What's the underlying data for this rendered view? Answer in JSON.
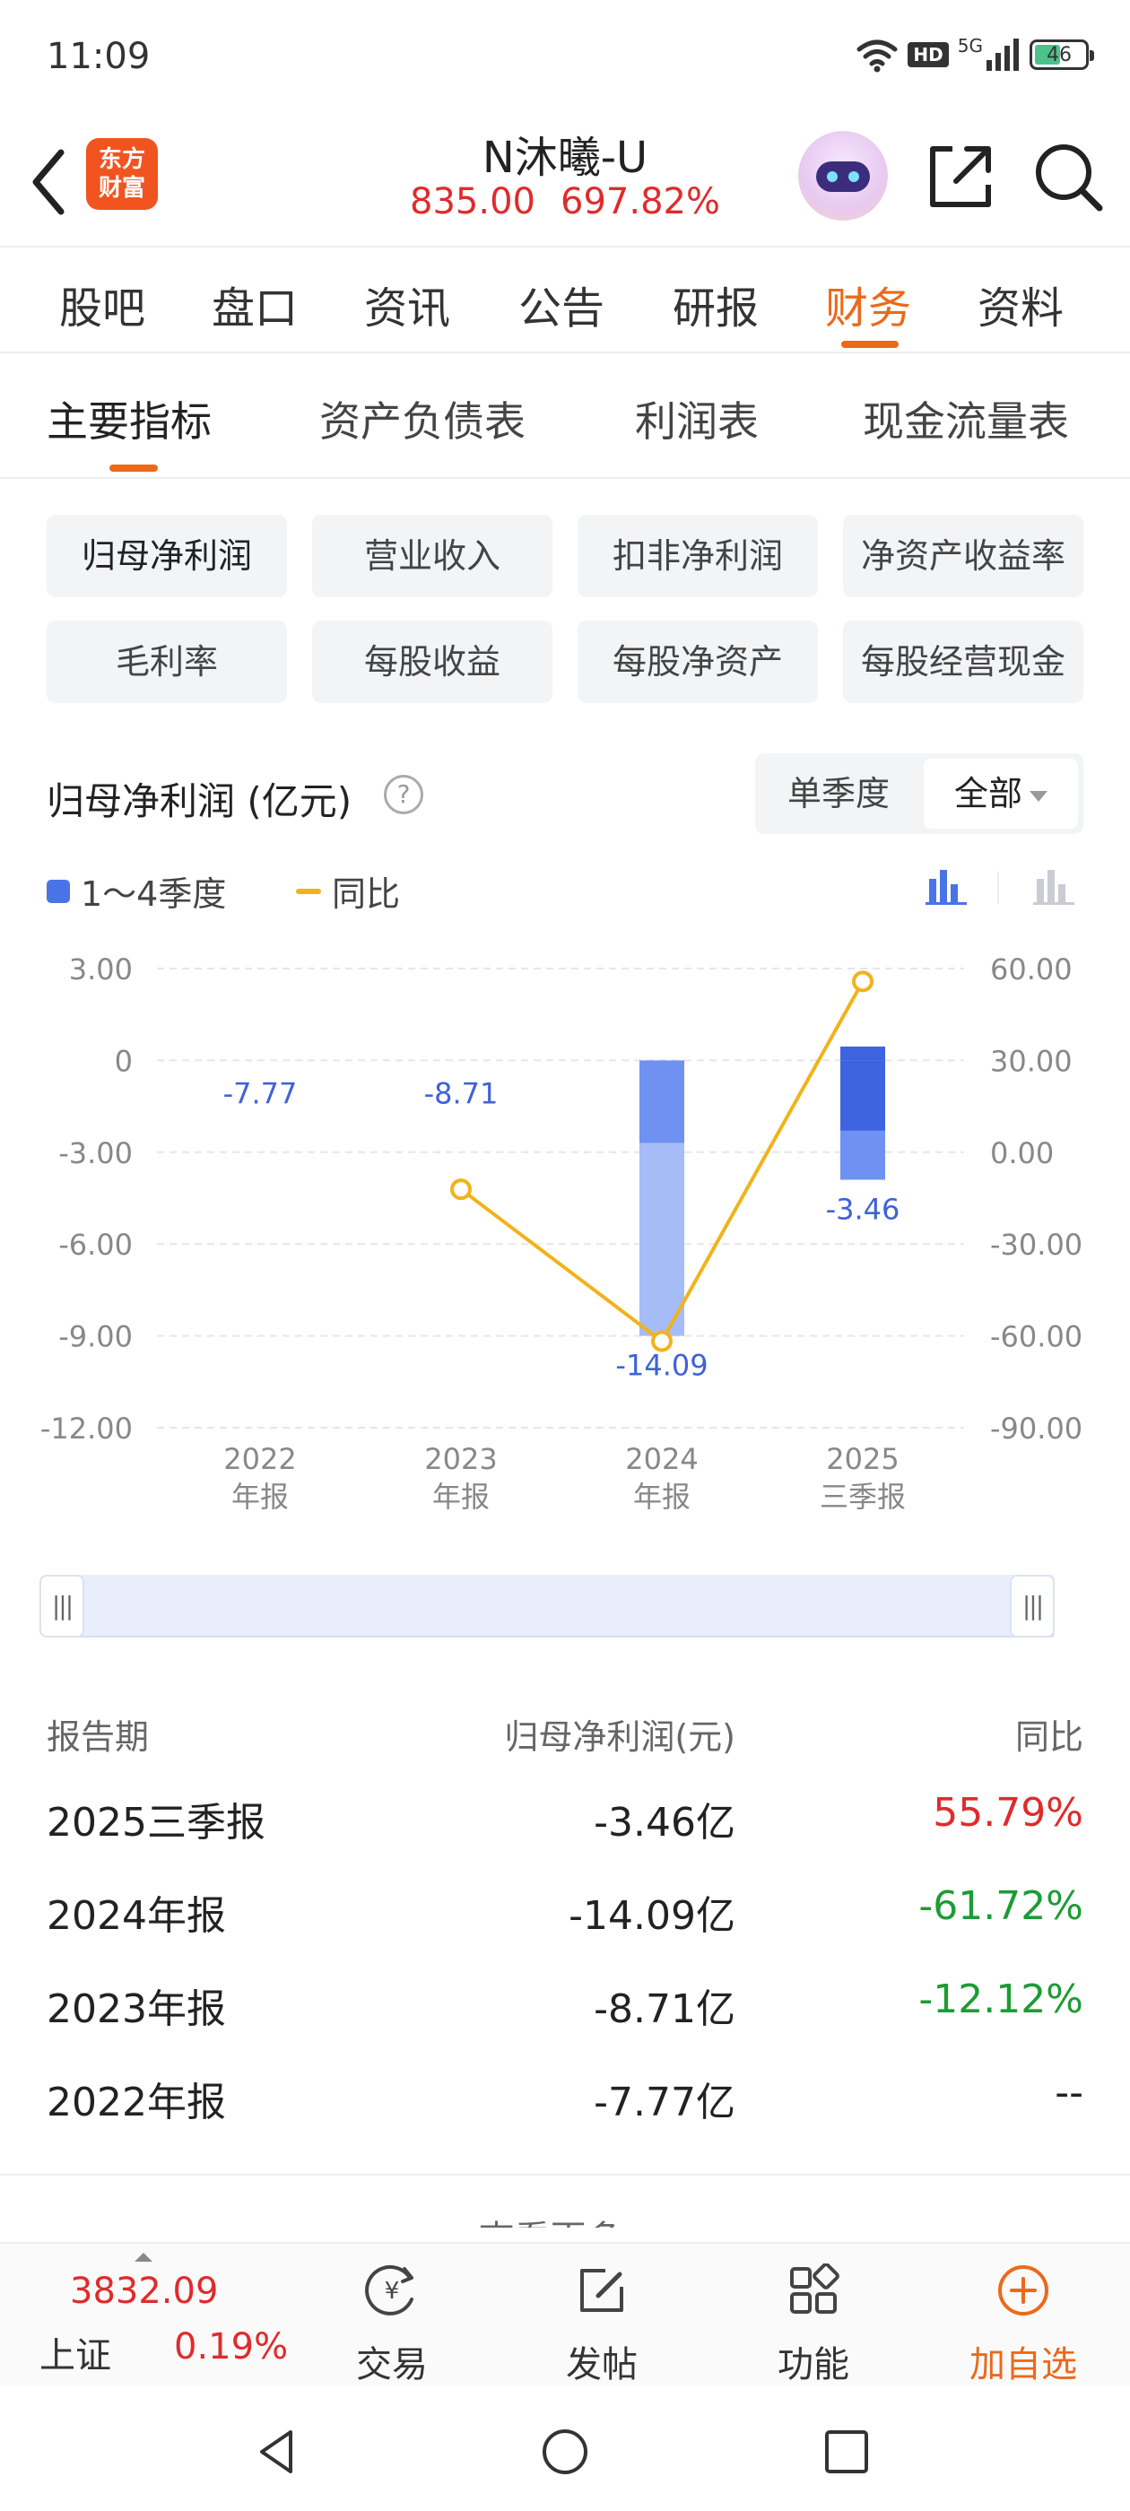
{
  "status": {
    "time": "11:09",
    "network": "5G",
    "hd": "HD",
    "battery": "46"
  },
  "header": {
    "logo": [
      "东方",
      "财富"
    ],
    "stock_name": "N沐曦-U",
    "price": "835.00",
    "change_pct": "697.82%"
  },
  "tabs": [
    "股吧",
    "盘口",
    "资讯",
    "公告",
    "研报",
    "财务",
    "资料"
  ],
  "active_tab": "财务",
  "subtabs": [
    "主要指标",
    "资产负债表",
    "利润表",
    "现金流量表"
  ],
  "active_subtab": "主要指标",
  "metric_chips": [
    "归母净利润",
    "营业收入",
    "扣非净利润",
    "净资产收益率",
    "毛利率",
    "每股收益",
    "每股净资产",
    "每股经营现金"
  ],
  "active_chip": "归母净利润",
  "chart_header": {
    "title": "归母净利润 (亿元)",
    "help": "?",
    "segment_left": "单季度",
    "segment_right": "全部"
  },
  "legend": {
    "bars": "1～4季度",
    "line": "同比"
  },
  "chart_data": {
    "type": "bar",
    "categories": [
      "2022\n年报",
      "2023\n年报",
      "2024\n年报",
      "2025\n三季报"
    ],
    "left_axis": {
      "ticks": [
        "3.00",
        "0",
        "-3.00",
        "-6.00",
        "-9.00",
        "-12.00"
      ],
      "ylim": [
        -12,
        3
      ]
    },
    "right_axis": {
      "ticks": [
        "60.00",
        "30.00",
        "0.00",
        "-30.00",
        "-60.00",
        "-90.00"
      ],
      "ylim": [
        -90,
        60
      ]
    },
    "bar_labels": [
      "-7.77",
      "-8.71",
      "-14.09",
      "-3.46"
    ],
    "yoy": [
      null,
      -12.12,
      -61.72,
      55.79
    ],
    "bar_segments_2024": [
      -2.7,
      -6.3
    ],
    "bar_segments_2025": [
      0.45,
      -2.3,
      -1.6
    ],
    "grid": true,
    "colors": {
      "bar_dark": "#3d63e0",
      "bar_mid": "#6f92f2",
      "bar_light": "#a6bcf7",
      "line": "#f0b31a",
      "label": "#3f62d6"
    }
  },
  "table": {
    "headers": [
      "报告期",
      "归母净利润(元)",
      "同比"
    ],
    "rows": [
      {
        "period": "2025三季报",
        "value": "-3.46亿",
        "yoy": "55.79%",
        "dir": "up"
      },
      {
        "period": "2024年报",
        "value": "-14.09亿",
        "yoy": "-61.72%",
        "dir": "down"
      },
      {
        "period": "2023年报",
        "value": "-8.71亿",
        "yoy": "-12.12%",
        "dir": "down"
      },
      {
        "period": "2022年报",
        "value": "-7.77亿",
        "yoy": "--",
        "dir": "none"
      }
    ],
    "more": "查看更多 ▸"
  },
  "bottom": {
    "index_value": "3832.09",
    "index_name": "上证",
    "index_pct": "0.19%",
    "buttons": [
      "交易",
      "发帖",
      "功能",
      "加自选"
    ]
  }
}
